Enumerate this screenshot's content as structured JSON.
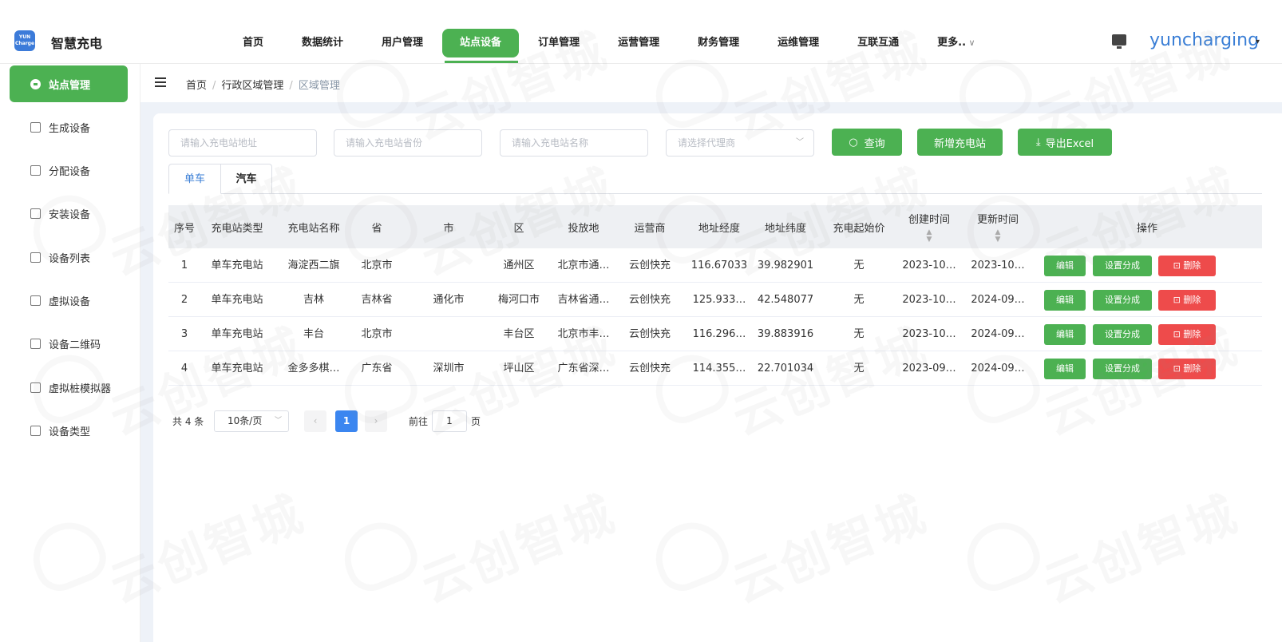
{
  "app": {
    "logo_text": "YUN Charge",
    "brand": "智慧充电",
    "user": "yuncharging"
  },
  "topnav": [
    "首页",
    "数据统计",
    "用户管理",
    "站点设备",
    "订单管理",
    "运营管理",
    "财务管理",
    "运维管理",
    "互联互通",
    "更多.."
  ],
  "topnav_active": "站点设备",
  "sidebar": [
    {
      "label": "站点管理",
      "icon": "station-icon",
      "active": true
    },
    {
      "label": "生成设备",
      "icon": "bag-icon"
    },
    {
      "label": "分配设备",
      "icon": "bag-share-icon"
    },
    {
      "label": "安装设备",
      "icon": "bag-install-icon"
    },
    {
      "label": "设备列表",
      "icon": "list-icon"
    },
    {
      "label": "虚拟设备",
      "icon": "link-icon"
    },
    {
      "label": "设备二维码",
      "icon": "document-icon"
    },
    {
      "label": "虚拟桩模拟器",
      "icon": "simulator-icon"
    },
    {
      "label": "设备类型",
      "icon": "gear-icon"
    }
  ],
  "breadcrumb": [
    "首页",
    "行政区域管理",
    "区域管理"
  ],
  "filters": {
    "address_placeholder": "请输入充电站地址",
    "province_placeholder": "请输入充电站省份",
    "name_placeholder": "请输入充电站名称",
    "agent_placeholder": "请选择代理商",
    "search_label": "查询",
    "add_label": "新增充电站",
    "export_label": "导出Excel"
  },
  "tabs": [
    "单车",
    "汽车"
  ],
  "table": {
    "columns": [
      "序号",
      "充电站类型",
      "充电站名称",
      "省",
      "市",
      "区",
      "投放地",
      "运营商",
      "地址经度",
      "地址纬度",
      "充电起始价",
      "创建时间",
      "更新时间",
      "操作"
    ],
    "rows": [
      [
        "1",
        "单车充电站",
        "海淀西二旗",
        "北京市",
        "",
        "通州区",
        "北京市通…",
        "云创快充",
        "116.67033",
        "39.982901",
        "无",
        "2023-10…",
        "2023-10…"
      ],
      [
        "2",
        "单车充电站",
        "吉林",
        "吉林省",
        "通化市",
        "梅河口市",
        "吉林省通…",
        "云创快充",
        "125.933…",
        "42.548077",
        "无",
        "2023-10…",
        "2024-09…"
      ],
      [
        "3",
        "单车充电站",
        "丰台",
        "北京市",
        "",
        "丰台区",
        "北京市丰…",
        "云创快充",
        "116.296…",
        "39.883916",
        "无",
        "2023-10…",
        "2024-09…"
      ],
      [
        "4",
        "单车充电站",
        "金多多棋…",
        "广东省",
        "深圳市",
        "坪山区",
        "广东省深…",
        "云创快充",
        "114.355…",
        "22.701034",
        "无",
        "2023-09…",
        "2024-09…"
      ]
    ],
    "actions": {
      "edit": "编辑",
      "split": "设置分成",
      "delete": "删除"
    }
  },
  "pager": {
    "total": "共 4 条",
    "size": "10条/页",
    "current": "1",
    "goto_prefix": "前往",
    "goto_value": "1",
    "goto_suffix": "页"
  },
  "watermark": "云创智城",
  "colors": {
    "green": "#4cb152",
    "blue": "#3b7fd6",
    "red": "#ee4b4b"
  }
}
